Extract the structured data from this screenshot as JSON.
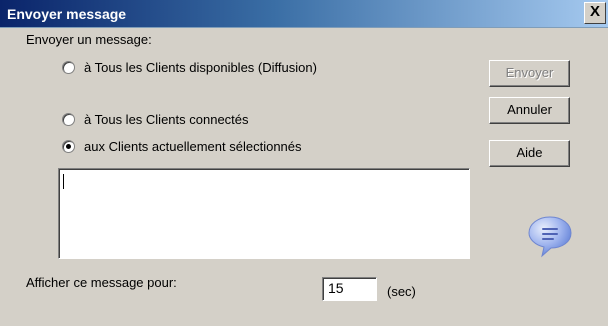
{
  "window": {
    "title": "Envoyer message",
    "close_glyph": "X"
  },
  "form": {
    "group_label": "Envoyer un message:",
    "options": [
      {
        "label": "à Tous les Clients disponibles (Diffusion)",
        "selected": false
      },
      {
        "label": "à Tous les Clients connectés",
        "selected": false
      },
      {
        "label": "aux Clients actuellement sélectionnés",
        "selected": true
      }
    ],
    "message_value": "",
    "duration_label": "Afficher ce message pour:",
    "duration_value": "15",
    "duration_unit": "(sec)"
  },
  "buttons": {
    "send": {
      "label": "Envoyer",
      "enabled": false
    },
    "cancel": {
      "label": "Annuler",
      "enabled": true
    },
    "help": {
      "label": "Aide",
      "enabled": true
    }
  },
  "icons": {
    "message_icon": "speech-bubble-icon"
  },
  "colors": {
    "dialog_bg": "#d4d0c8",
    "title_start": "#0a246a",
    "title_end": "#a6caf0",
    "icon_blue": "#7f9ce8"
  }
}
